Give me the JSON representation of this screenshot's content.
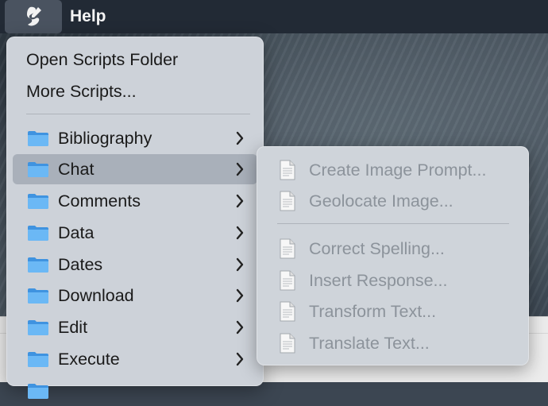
{
  "menubar": {
    "help_label": "Help"
  },
  "menu": {
    "plain_items": [
      {
        "label": "Open Scripts Folder"
      },
      {
        "label": "More Scripts..."
      }
    ],
    "folders": [
      {
        "label": "Bibliography"
      },
      {
        "label": "Chat",
        "highlighted": true
      },
      {
        "label": "Comments"
      },
      {
        "label": "Data"
      },
      {
        "label": "Dates"
      },
      {
        "label": "Download"
      },
      {
        "label": "Edit"
      },
      {
        "label": "Execute"
      }
    ]
  },
  "submenu": {
    "group1": [
      {
        "label": "Create Image Prompt..."
      },
      {
        "label": "Geolocate Image..."
      }
    ],
    "group2": [
      {
        "label": "Correct Spelling..."
      },
      {
        "label": "Insert Response..."
      },
      {
        "label": "Transform Text..."
      },
      {
        "label": "Translate Text..."
      }
    ]
  },
  "colors": {
    "menubar_bg": "#222a35",
    "menu_bg": "#cdd2d9",
    "highlight_bg": "#a9b0ba",
    "folder_blue": "#5aaef0",
    "disabled_text": "#8c939b"
  },
  "icons": {
    "app": "script-app-icon",
    "folder": "folder-icon",
    "chevron": "chevron-right-icon",
    "document": "document-icon"
  }
}
